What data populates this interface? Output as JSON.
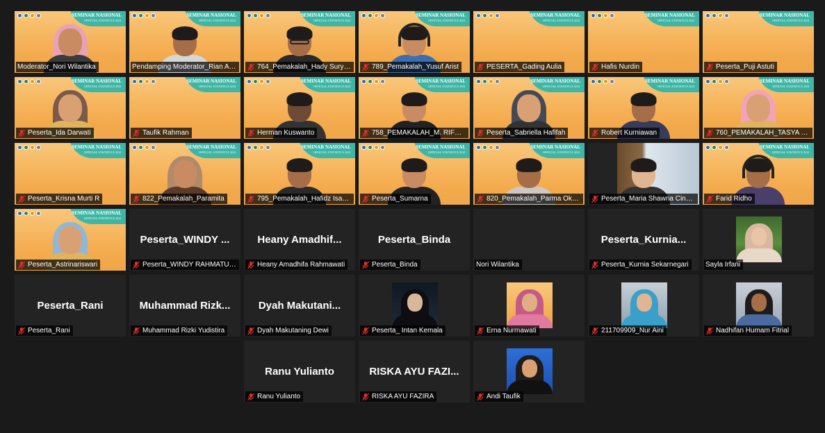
{
  "webinar_banner": {
    "title": "SEMINAR NASIONAL",
    "subtitle": "OFFICIAL STATISTICS 2021"
  },
  "colors": {
    "background": "#1a1a1a",
    "tile": "#232323",
    "active_speaker_border": "#a4c639",
    "muted_mic": "#e02d2d",
    "banner_teal": "#3fb6a5",
    "banner_orange": "#f6b055"
  },
  "participants": [
    {
      "name": "Moderator_Nori Wilantika",
      "video": "on",
      "muted": false,
      "big": ""
    },
    {
      "name": "Pendamping Moderator_Rian Al...",
      "video": "on",
      "muted": false,
      "speaking": true,
      "big": ""
    },
    {
      "name": "764_Pemakalah_Hady Suryo...",
      "video": "on",
      "muted": true,
      "big": ""
    },
    {
      "name": "789_Pemakalah_Yusuf Arist",
      "video": "on",
      "muted": true,
      "big": ""
    },
    {
      "name": "PESERTA_Gading Aulia",
      "video": "on",
      "muted": true,
      "big": ""
    },
    {
      "name": "Hafis Nurdin",
      "video": "on",
      "muted": true,
      "big": ""
    },
    {
      "name": "Peserta_Puji Astuti",
      "video": "on",
      "muted": true,
      "big": ""
    },
    {
      "name": "Peserta_Ida Darwati",
      "video": "on",
      "muted": true,
      "big": ""
    },
    {
      "name": "Taufik Rahman",
      "video": "on",
      "muted": true,
      "big": ""
    },
    {
      "name": "Herman Kuswanto",
      "video": "on",
      "muted": true,
      "big": ""
    },
    {
      "name": "758_PEMAKALAH_M. RIFKY ...",
      "video": "on",
      "muted": true,
      "big": ""
    },
    {
      "name": "Peserta_Sabriella Hafifah",
      "video": "on",
      "muted": true,
      "big": ""
    },
    {
      "name": "Robert Kurniawan",
      "video": "on",
      "muted": true,
      "big": ""
    },
    {
      "name": "760_PEMAKALAH_TASYA MI...",
      "video": "on",
      "muted": true,
      "big": ""
    },
    {
      "name": "Peserta_Krisna Murti R",
      "video": "on",
      "muted": true,
      "big": ""
    },
    {
      "name": "822_Pemakalah_Paramita",
      "video": "on",
      "muted": true,
      "big": ""
    },
    {
      "name": "795_Pemakalah_Hafidz Isa NL",
      "video": "on",
      "muted": true,
      "big": ""
    },
    {
      "name": "Peserta_Sumarna",
      "video": "on",
      "muted": true,
      "big": ""
    },
    {
      "name": "820_Pemakalah_Parma Okta...",
      "video": "on",
      "muted": true,
      "big": ""
    },
    {
      "name": "Peserta_Maria Shawna Cinn...",
      "video": "on",
      "muted": true,
      "big": ""
    },
    {
      "name": "Farid Ridho",
      "video": "on",
      "muted": true,
      "big": ""
    },
    {
      "name": "Peserta_Astrinariswari",
      "video": "on",
      "muted": true,
      "big": ""
    },
    {
      "name": "Peserta_WINDY RAHMATUL ...",
      "video": "off",
      "muted": true,
      "big": "Peserta_WINDY ..."
    },
    {
      "name": "Heany Amadhifa Rahmawati",
      "video": "off",
      "muted": true,
      "big": "Heany  Amadhif..."
    },
    {
      "name": "Peserta_Binda",
      "video": "off",
      "muted": true,
      "big": "Peserta_Binda"
    },
    {
      "name": "Nori Wilantika",
      "video": "blank",
      "muted": false,
      "big": ""
    },
    {
      "name": "Peserta_Kurnia Sekarnegari",
      "video": "off",
      "muted": true,
      "big": "Peserta_Kurnia..."
    },
    {
      "name": "Sayla Irfani",
      "video": "photo",
      "muted": false,
      "big": ""
    },
    {
      "name": "Peserta_Rani",
      "video": "off",
      "muted": true,
      "big": "Peserta_Rani"
    },
    {
      "name": "Muhammad Rizki Yudistira",
      "video": "off",
      "muted": true,
      "big": "Muhammad  Rizk..."
    },
    {
      "name": "Dyah Makutaning Dewi",
      "video": "off",
      "muted": true,
      "big": "Dyah  Makutani..."
    },
    {
      "name": "Peserta_ Intan Kemala",
      "video": "photo",
      "muted": true,
      "big": ""
    },
    {
      "name": "Erna Nurmawati",
      "video": "photo",
      "muted": true,
      "big": ""
    },
    {
      "name": "211709909_Nur Aini",
      "video": "photo",
      "muted": true,
      "big": ""
    },
    {
      "name": "Nadhifan Humam Fitrial",
      "video": "photo",
      "muted": true,
      "big": ""
    },
    {
      "name": "Ranu Yulianto",
      "video": "off",
      "muted": true,
      "big": "Ranu Yulianto"
    },
    {
      "name": "RISKA AYU FAZIRA",
      "video": "off",
      "muted": true,
      "big": "RISKA  AYU  FAZI..."
    },
    {
      "name": "Andi Taufik",
      "video": "photo",
      "muted": true,
      "big": ""
    }
  ]
}
